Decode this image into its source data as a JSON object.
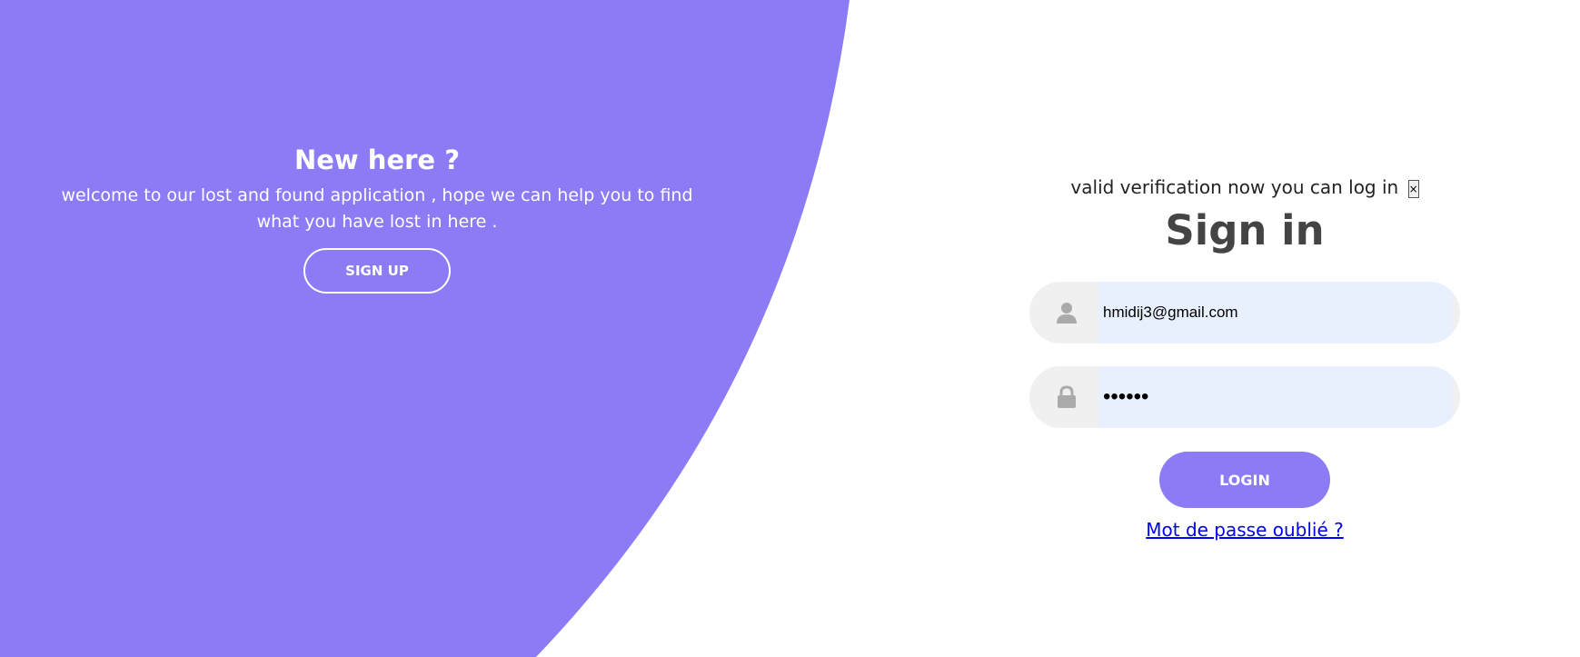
{
  "colors": {
    "accent": "#8b7cf6",
    "field_background": "#f0f0f0",
    "input_autofill_background": "#e8f0fe",
    "heading": "#444444",
    "link": "#0000ee"
  },
  "left_panel": {
    "title": "New here ?",
    "text": "welcome to our lost and found application , hope we can help you to find what you have lost in here .",
    "signup_label": "SIGN UP"
  },
  "sign_in": {
    "alert_text": "valid verification now you can log in",
    "alert_close": "×",
    "title": "Sign in",
    "username": {
      "icon": "user-icon",
      "value": "hmidij3@gmail.com"
    },
    "password": {
      "icon": "lock-icon",
      "value": "••••••"
    },
    "login_label": "LOGIN",
    "forgot_password": "Mot de passe oublié ?"
  }
}
